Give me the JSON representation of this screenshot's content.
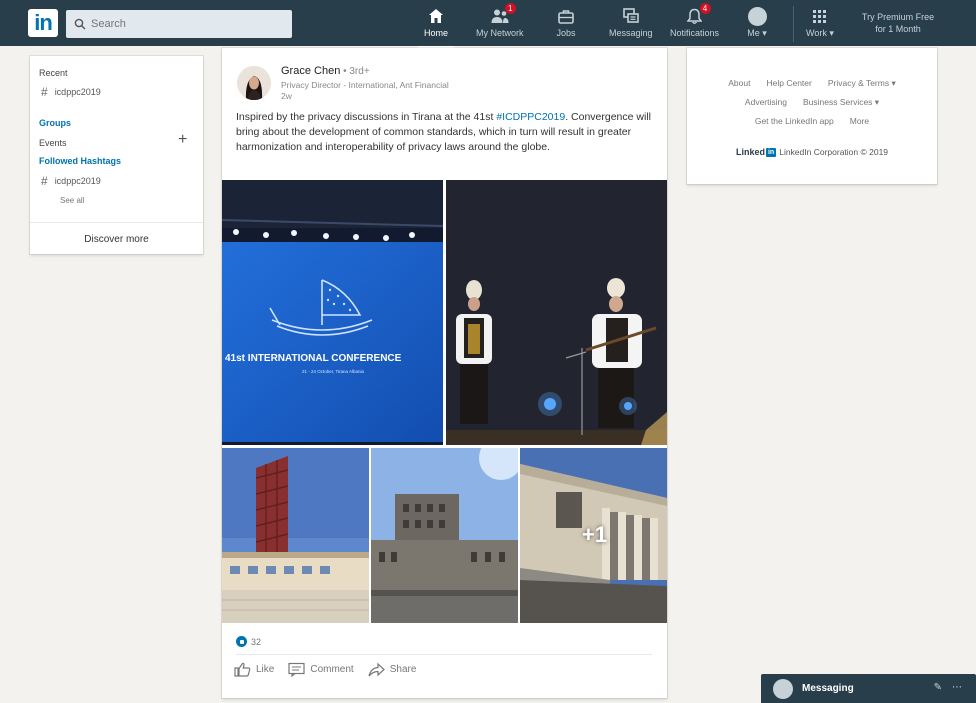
{
  "nav": {
    "logo": "in",
    "search_placeholder": "Search",
    "items": [
      {
        "label": "Home",
        "icon": "home-icon"
      },
      {
        "label": "My Network",
        "icon": "network-icon",
        "badge": "1"
      },
      {
        "label": "Jobs",
        "icon": "briefcase-icon"
      },
      {
        "label": "Messaging",
        "icon": "messaging-icon"
      },
      {
        "label": "Notifications",
        "icon": "bell-icon",
        "badge": "4"
      },
      {
        "label": "Me ▾",
        "icon": "avatar"
      },
      {
        "label": "Work ▾",
        "icon": "grid-icon"
      }
    ],
    "premium_line1": "Try Premium Free",
    "premium_line2": "for 1 Month",
    "active_color": "#ffffff",
    "bar_color": "#283e4a"
  },
  "left": {
    "recent": "Recent",
    "recent_tag": "icdppc2019",
    "groups": "Groups",
    "events": "Events",
    "followed": "Followed Hashtags",
    "followed_tag": "icdppc2019",
    "see_all": "See all",
    "discover": "Discover more"
  },
  "post": {
    "author": "Grace Chen",
    "degree": " • 3rd+",
    "headline": "Privacy Director - International, Ant Financial",
    "age": "2w",
    "text_before": "Inspired by the privacy discussions in Tirana at the 41st ",
    "hashtag": "#ICDPPC2019",
    "text_after": ". Convergence will bring about the development of common standards, which in turn will result in greater harmonization and interoperability of privacy laws around the globe.",
    "photo1_caption": "41st INTERNATIONAL CONFERENCE",
    "photo1_small": "21 - 24 October, Tirana Albania",
    "more_photos": "+1",
    "reaction_count": "32",
    "actions": {
      "like": "Like",
      "comment": "Comment",
      "share": "Share"
    }
  },
  "right": {
    "about": "About",
    "help": "Help Center",
    "privacy": "Privacy & Terms ▾",
    "advertising": "Advertising",
    "business": "Business Services ▾",
    "app": "Get the LinkedIn app",
    "more": "More",
    "brand_word": "Linked",
    "brand_box": "in",
    "copyright": "LinkedIn Corporation © 2019"
  },
  "messaging": {
    "label": "Messaging"
  }
}
